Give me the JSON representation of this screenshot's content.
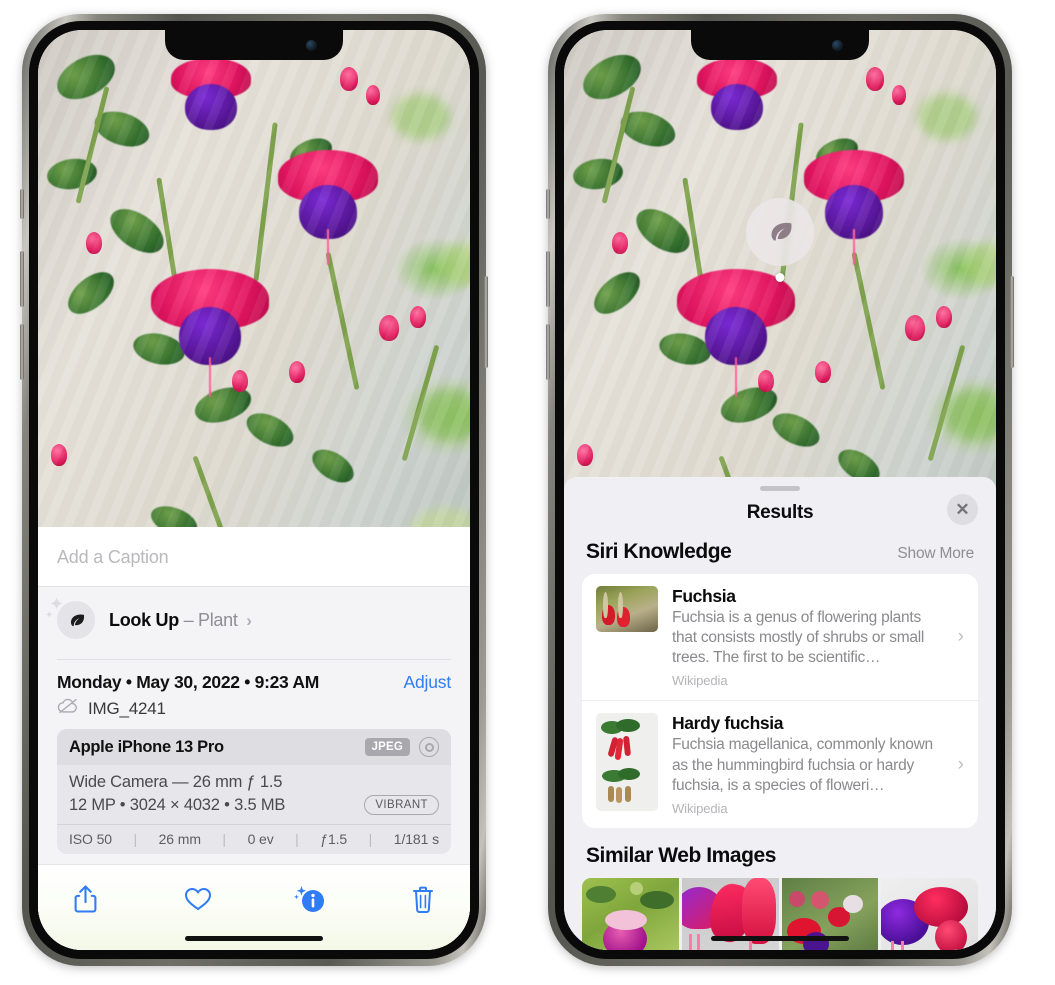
{
  "meta": {
    "description": "Two iPhone screenshots side by side showing the iOS Photos app Visual Look Up feature",
    "accent_blue": "#2f7cf6",
    "sheet_bg": "#f0eff4"
  },
  "left_phone": {
    "caption_field": {
      "placeholder": "Add a Caption",
      "value": ""
    },
    "lookup_row": {
      "icon": "leaf-icon",
      "label": "Look Up",
      "dash": "–",
      "subject": "Plant",
      "chevron": "›"
    },
    "photo_meta": {
      "date": "Monday • May 30, 2022 • 9:23 AM",
      "adjust_label": "Adjust",
      "cloud_icon": "cloud-slash-icon",
      "filename": "IMG_4241"
    },
    "camera_card": {
      "device": "Apple iPhone 13 Pro",
      "format_badge": "JPEG",
      "hdr_icon": "hdr-ring-icon",
      "lens_line": "Wide Camera — 26 mm ƒ 1.5",
      "size_line": "12 MP • 3024 × 4032 • 3.5 MB",
      "vibrant_badge": "VIBRANT",
      "exif": [
        "ISO 50",
        "26 mm",
        "0 ev",
        "ƒ1.5",
        "1/181 s"
      ]
    },
    "toolbar": [
      {
        "name": "share-icon",
        "label": "Share"
      },
      {
        "name": "heart-icon",
        "label": "Favorite"
      },
      {
        "name": "info-sparkle-icon",
        "label": "Info",
        "active": true
      },
      {
        "name": "trash-icon",
        "label": "Delete"
      }
    ]
  },
  "right_phone": {
    "leaf_badge_icon": "leaf-icon",
    "sheet": {
      "grabber": "drag-handle",
      "title": "Results",
      "close_icon": "close-icon"
    },
    "siri_knowledge": {
      "section_title": "Siri Knowledge",
      "show_more": "Show More",
      "results": [
        {
          "title": "Fuchsia",
          "description": "Fuchsia is a genus of flowering plants that consists mostly of shrubs or small trees. The first to be scientific…",
          "source": "Wikipedia",
          "chevron": "›"
        },
        {
          "title": "Hardy fuchsia",
          "description": "Fuchsia magellanica, commonly known as the hummingbird fuchsia or hardy fuchsia, is a species of floweri…",
          "source": "Wikipedia",
          "chevron": "›"
        }
      ]
    },
    "similar_web_images": {
      "section_title": "Similar Web Images",
      "tiles": [
        {
          "alt": "pink and magenta fuchsia flower with green leaves"
        },
        {
          "alt": "close-up of red and magenta fuchsia blossoms"
        },
        {
          "alt": "fuchsia bush with red and purple flowers"
        },
        {
          "alt": "purple and magenta double fuchsia bloom"
        }
      ]
    }
  }
}
